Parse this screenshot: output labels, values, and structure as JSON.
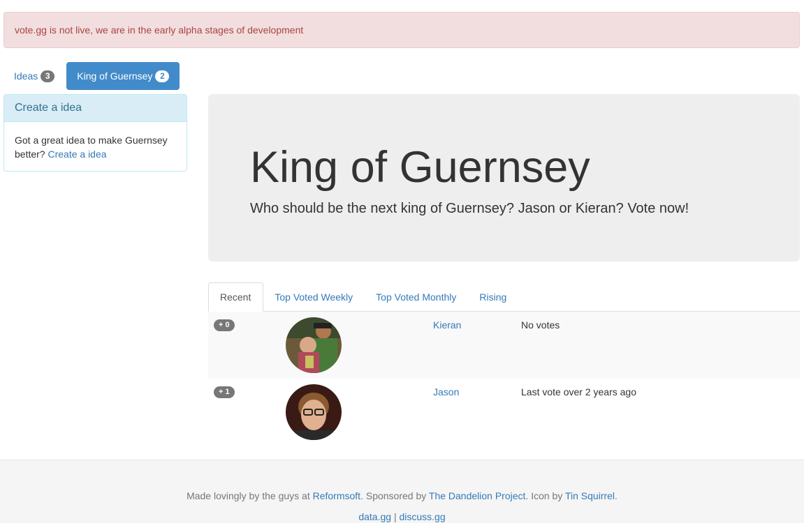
{
  "alert": {
    "text": "vote.gg is not live, we are in the early alpha stages of development"
  },
  "nav": {
    "pills": [
      {
        "label": "Ideas",
        "badge": "3"
      },
      {
        "label": "King of Guernsey",
        "badge": "2"
      }
    ]
  },
  "sidebar": {
    "heading": "Create a idea",
    "body_text": "Got a great idea to make Guernsey better?",
    "link": "Create a idea"
  },
  "jumbotron": {
    "title": "King of Guernsey",
    "subtitle": "Who should be the next king of Guernsey? Jason or Kieran? Vote now!"
  },
  "tabs": [
    "Recent",
    "Top Voted Weekly",
    "Top Voted Monthly",
    "Rising"
  ],
  "candidates": [
    {
      "score": "+ 0",
      "name": "Kieran",
      "status": "No votes",
      "avatar_icon": "kieran-avatar"
    },
    {
      "score": "+ 1",
      "name": "Jason",
      "status": "Last vote over 2 years ago",
      "avatar_icon": "jason-avatar"
    }
  ],
  "footer": {
    "made_by_prefix": "Made lovingly by the guys at",
    "reformsoft": "Reformsoft",
    "sponsored_prefix": ". Sponsored by",
    "dandelion": "The Dandelion Project",
    "icon_prefix": ". Icon by",
    "tin_squirrel": "Tin Squirrel",
    "suffix": ".",
    "data_link": "data.gg",
    "separator": "|",
    "discuss_link": "discuss.gg"
  }
}
